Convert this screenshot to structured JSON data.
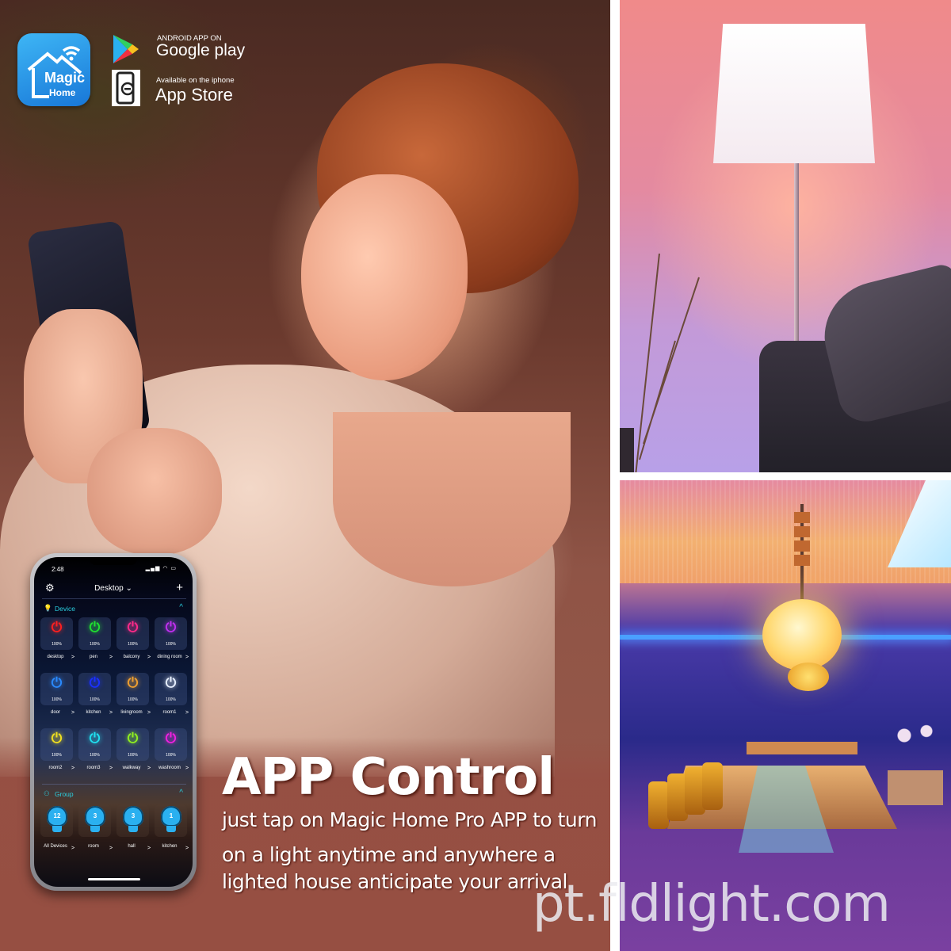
{
  "badges": {
    "app_icon": {
      "line1": "Magic",
      "line2": "Home",
      "icon": "magic-home-app-icon"
    },
    "google_play": {
      "small": "ANDROID APP ON",
      "big": "Google play",
      "icon": "google-play-icon"
    },
    "app_store": {
      "small": "Available on the iphone",
      "big": "App Store",
      "icon": "iphone-icon"
    }
  },
  "phone": {
    "time": "2:48",
    "status_icons": "signal wifi battery",
    "title": "Desktop",
    "title_chevron": "⌄",
    "settings_icon": "⚙",
    "add_icon": "+",
    "device_section": {
      "label": "Device",
      "icon": "lightbulb-icon",
      "chevron": "^"
    },
    "devices": [
      {
        "name": "desktop",
        "percent": "100%",
        "color": "#ff2020"
      },
      {
        "name": "pen",
        "percent": "100%",
        "color": "#20e030"
      },
      {
        "name": "balcony",
        "percent": "100%",
        "color": "#ff2a8a"
      },
      {
        "name": "dining room",
        "percent": "100%",
        "color": "#c030f0"
      },
      {
        "name": "door",
        "percent": "100%",
        "color": "#2a8aff"
      },
      {
        "name": "kitchen",
        "percent": "100%",
        "color": "#1a30ff"
      },
      {
        "name": "livingroom",
        "percent": "100%",
        "color": "#f0a030"
      },
      {
        "name": "room1",
        "percent": "100%",
        "color": "#e8f0ff"
      },
      {
        "name": "room2",
        "percent": "100%",
        "color": "#f0e020"
      },
      {
        "name": "room3",
        "percent": "100%",
        "color": "#20e0f0"
      },
      {
        "name": "walkway",
        "percent": "100%",
        "color": "#90f020"
      },
      {
        "name": "washroom",
        "percent": "100%",
        "color": "#f020e0"
      }
    ],
    "group_section": {
      "label": "Group",
      "icon": "group-icon",
      "chevron": "^"
    },
    "groups": [
      {
        "name": "All Devices",
        "count": "12"
      },
      {
        "name": "room",
        "count": "3"
      },
      {
        "name": "hall",
        "count": "3"
      },
      {
        "name": "kitchen",
        "count": "1"
      }
    ],
    "row_chevron": ">"
  },
  "headline": "APP  Control",
  "subtext": [
    "just tap on Magic Home Pro APP to turn",
    "on a light anytime and anywhere a",
    "lighted house anticipate your arrival"
  ],
  "watermark": "pt.fldlight.com",
  "colors": {
    "accent_cyan": "#2ad0e0",
    "bulb_blue": "#2ab0f0",
    "app_icon_blue": "#1877d8",
    "text_panel": "#964f42"
  }
}
